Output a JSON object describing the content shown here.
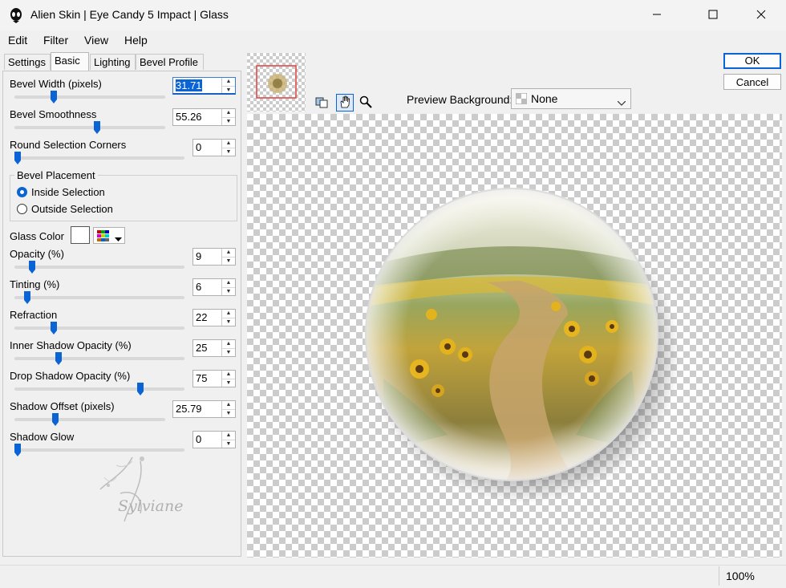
{
  "window": {
    "title": "Alien Skin | Eye Candy 5 Impact | Glass",
    "icon": "alien-head-icon"
  },
  "menu": [
    "Edit",
    "Filter",
    "View",
    "Help"
  ],
  "tabs": [
    "Settings",
    "Basic",
    "Lighting",
    "Bevel Profile"
  ],
  "active_tab": "Basic",
  "controls": {
    "bevel_width": {
      "label": "Bevel Width (pixels)",
      "value": "31.71",
      "slider": 0.25
    },
    "bevel_smoothness": {
      "label": "Bevel Smoothness",
      "value": "55.26",
      "slider": 0.55
    },
    "round_corners": {
      "label": "Round Selection Corners",
      "value": "0",
      "slider": 0.0
    },
    "bevel_placement": {
      "title": "Bevel Placement",
      "options": [
        "Inside Selection",
        "Outside Selection"
      ],
      "selected": "Inside Selection"
    },
    "glass_color": {
      "label": "Glass Color",
      "color": "#ffffff"
    },
    "opacity": {
      "label": "Opacity (%)",
      "value": "9",
      "slider": 0.09
    },
    "tinting": {
      "label": "Tinting (%)",
      "value": "6",
      "slider": 0.06
    },
    "refraction": {
      "label": "Refraction",
      "value": "22",
      "slider": 0.22
    },
    "inner_shadow": {
      "label": "Inner Shadow Opacity (%)",
      "value": "25",
      "slider": 0.25
    },
    "drop_shadow": {
      "label": "Drop Shadow Opacity (%)",
      "value": "75",
      "slider": 0.75
    },
    "shadow_offset": {
      "label": "Shadow Offset (pixels)",
      "value": "25.79",
      "slider": 0.26
    },
    "shadow_glow": {
      "label": "Shadow Glow",
      "value": "0",
      "slider": 0.0
    }
  },
  "watermark": "Sylviane",
  "buttons": {
    "ok": "OK",
    "cancel": "Cancel"
  },
  "preview_background": {
    "label": "Preview Background:",
    "value": "None"
  },
  "zoom": "100%",
  "colors": {
    "accent": "#0a64d6"
  }
}
